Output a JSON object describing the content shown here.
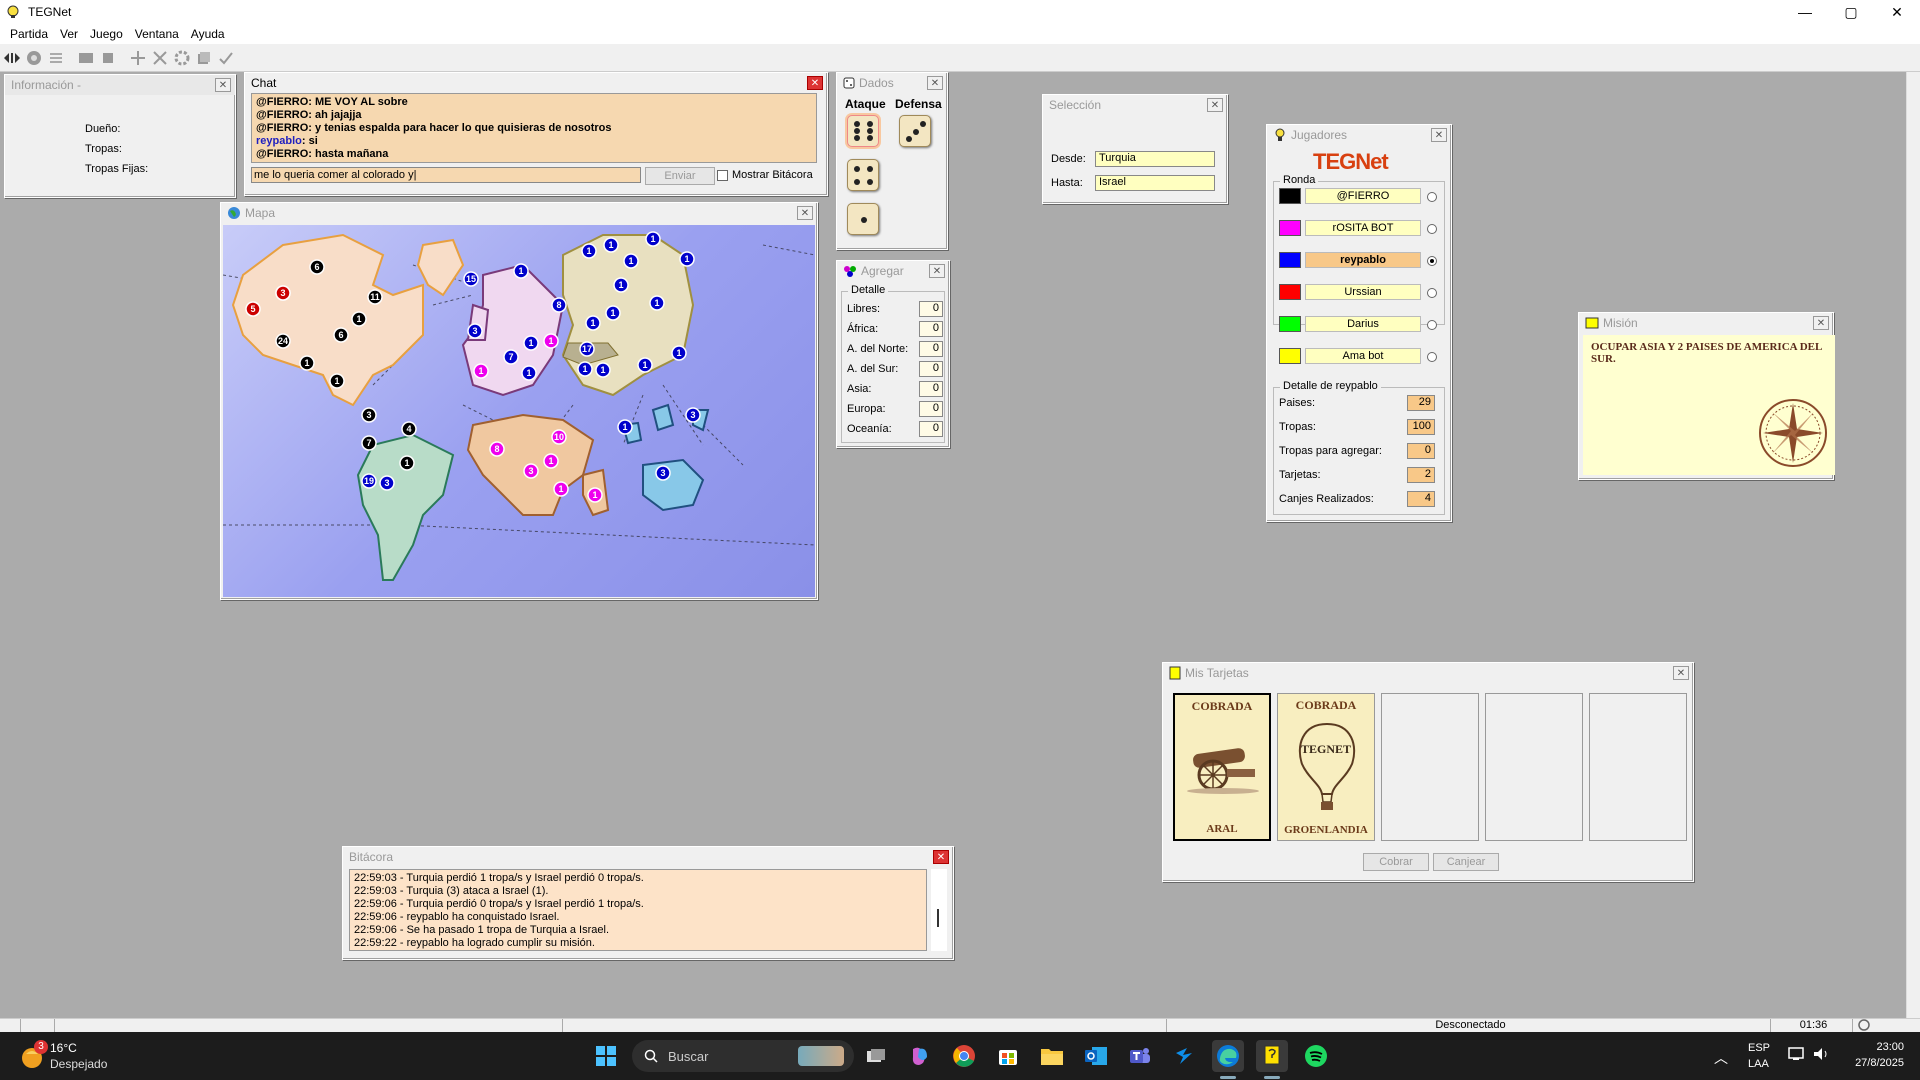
{
  "window": {
    "title": "TEGNet",
    "minimize": "—",
    "maximize": "▢",
    "close": "✕"
  },
  "menu": [
    "Partida",
    "Ver",
    "Juego",
    "Ventana",
    "Ayuda"
  ],
  "info": {
    "title": "Información -",
    "labels": [
      "Dueño:",
      "Tropas:",
      "Tropas Fijas:"
    ]
  },
  "chat": {
    "title": "Chat",
    "lines": [
      {
        "nick": "@FIERRO",
        "text": ": ME VOY AL sobre",
        "me": false
      },
      {
        "nick": "@FIERRO",
        "text": ": ah jajajja",
        "me": false
      },
      {
        "nick": "@FIERRO",
        "text": ": y tenias espalda para hacer lo que quisieras de nosotros",
        "me": false
      },
      {
        "nick": "reypablo",
        "text": ": si",
        "me": true
      },
      {
        "nick": "@FIERRO",
        "text": ": hasta mañana",
        "me": false
      }
    ],
    "input_value": "me lo queria comer al colorado y|",
    "send_label": "Enviar",
    "show_log_label": "Mostrar Bitácora"
  },
  "dados": {
    "title": "Dados",
    "attack_label": "Ataque",
    "defense_label": "Defensa",
    "attack_dice": [
      6,
      4,
      1
    ],
    "defense_dice": [
      3
    ]
  },
  "agregar": {
    "title": "Agregar",
    "group_label": "Detalle",
    "rows": [
      {
        "label": "Libres:",
        "value": "0"
      },
      {
        "label": "África:",
        "value": "0"
      },
      {
        "label": "A. del Norte:",
        "value": "0"
      },
      {
        "label": "A. del Sur:",
        "value": "0"
      },
      {
        "label": "Asia:",
        "value": "0"
      },
      {
        "label": "Europa:",
        "value": "0"
      },
      {
        "label": "Oceanía:",
        "value": "0"
      }
    ]
  },
  "seleccion": {
    "title": "Selección",
    "from_label": "Desde:",
    "from_value": "Turquia",
    "to_label": "Hasta:",
    "to_value": "Israel"
  },
  "jugadores": {
    "title": "Jugadores",
    "logo": "TEGNet",
    "round_label": "Ronda",
    "players": [
      {
        "name": "@FIERRO",
        "color": "#000000",
        "current": false
      },
      {
        "name": "rOSITA BOT",
        "color": "#ff00ff",
        "current": false
      },
      {
        "name": "reypablo",
        "color": "#0000ff",
        "current": true
      },
      {
        "name": "Urssian",
        "color": "#ff0000",
        "current": false
      },
      {
        "name": "Darius",
        "color": "#00ff00",
        "current": false
      },
      {
        "name": "Ama bot",
        "color": "#ffff00",
        "current": false
      }
    ],
    "detail_label": "Detalle de reypablo",
    "details": [
      {
        "label": "Paises:",
        "value": "29"
      },
      {
        "label": "Tropas:",
        "value": "100"
      },
      {
        "label": "Tropas para agregar:",
        "value": "0"
      },
      {
        "label": "Tarjetas:",
        "value": "2"
      },
      {
        "label": "Canjes Realizados:",
        "value": "4"
      }
    ]
  },
  "mision": {
    "title": "Misión",
    "text": "OCUPAR ASIA Y 2 PAISES DE AMERICA DEL SUR."
  },
  "mapa": {
    "title": "Mapa",
    "armies": [
      {
        "n": "6",
        "c": "#000"
      },
      {
        "n": "3",
        "c": "#000"
      },
      {
        "n": "5",
        "c": "#c00"
      },
      {
        "n": "3",
        "c": "#c00"
      },
      {
        "n": "11",
        "c": "#000"
      },
      {
        "n": "1",
        "c": "#000"
      },
      {
        "n": "6",
        "c": "#000"
      },
      {
        "n": "24",
        "c": "#000"
      },
      {
        "n": "1",
        "c": "#000"
      },
      {
        "n": "1",
        "c": "#000"
      },
      {
        "n": "3",
        "c": "#000"
      },
      {
        "n": "4",
        "c": "#000"
      },
      {
        "n": "7",
        "c": "#000"
      },
      {
        "n": "1",
        "c": "#000"
      },
      {
        "n": "19",
        "c": "#00c"
      },
      {
        "n": "3",
        "c": "#00c"
      },
      {
        "n": "15",
        "c": "#00c"
      },
      {
        "n": "1",
        "c": "#00c"
      },
      {
        "n": "8",
        "c": "#00c"
      },
      {
        "n": "3",
        "c": "#00c"
      },
      {
        "n": "7",
        "c": "#00c"
      },
      {
        "n": "1",
        "c": "#00c"
      },
      {
        "n": "1",
        "c": "#e0e"
      },
      {
        "n": "1",
        "c": "#e0e"
      },
      {
        "n": "1",
        "c": "#00c"
      },
      {
        "n": "17",
        "c": "#00c"
      },
      {
        "n": "1",
        "c": "#00c"
      },
      {
        "n": "1",
        "c": "#00c"
      },
      {
        "n": "1",
        "c": "#00c"
      },
      {
        "n": "1",
        "c": "#00c"
      },
      {
        "n": "3",
        "c": "#00c"
      },
      {
        "n": "1",
        "c": "#00c"
      },
      {
        "n": "1",
        "c": "#00c"
      },
      {
        "n": "1",
        "c": "#00c"
      },
      {
        "n": "1",
        "c": "#00c"
      },
      {
        "n": "1",
        "c": "#00c"
      },
      {
        "n": "1",
        "c": "#00c"
      },
      {
        "n": "1",
        "c": "#00c"
      },
      {
        "n": "1",
        "c": "#00c"
      },
      {
        "n": "1",
        "c": "#00c"
      },
      {
        "n": "1",
        "c": "#00c"
      },
      {
        "n": "3",
        "c": "#00c"
      },
      {
        "n": "8",
        "c": "#e0e"
      },
      {
        "n": "10",
        "c": "#e0e"
      },
      {
        "n": "1",
        "c": "#e0e"
      },
      {
        "n": "3",
        "c": "#e0e"
      },
      {
        "n": "1",
        "c": "#e0e"
      },
      {
        "n": "1",
        "c": "#e0e"
      }
    ]
  },
  "tarjetas": {
    "title": "Mis Tarjetas",
    "cards": [
      {
        "status": "COBRADA",
        "country": "ARAL",
        "icon": "cannon-icon"
      },
      {
        "status": "COBRADA",
        "country": "GROENLANDIA",
        "icon": "balloon-icon",
        "art": "TEGNET"
      }
    ],
    "collect_label": "Cobrar",
    "trade_label": "Canjear"
  },
  "bitacora": {
    "title": "Bitácora",
    "lines": [
      "22:59:03 - Turquia perdió 1 tropa/s y Israel perdió 0 tropa/s.",
      "22:59:03 - Turquia (3) ataca a Israel (1).",
      "22:59:06 - Turquia perdió 0 tropa/s y Israel perdió 1 tropa/s.",
      "22:59:06 - reypablo ha conquistado Israel.",
      "22:59:06 - Se ha pasado 1 tropa de Turquia a Israel.",
      "22:59:22 - reypablo ha logrado cumplir su misión."
    ]
  },
  "status": {
    "connection": "Desconectado",
    "time": "01:36"
  },
  "taskbar": {
    "weather_temp": "16°C",
    "weather_desc": "Despejado",
    "weather_badge": "3",
    "search_placeholder": "Buscar",
    "lang": "ESP",
    "lang2": "LAA",
    "clock_time": "23:00",
    "clock_date": "27/8/2025"
  }
}
